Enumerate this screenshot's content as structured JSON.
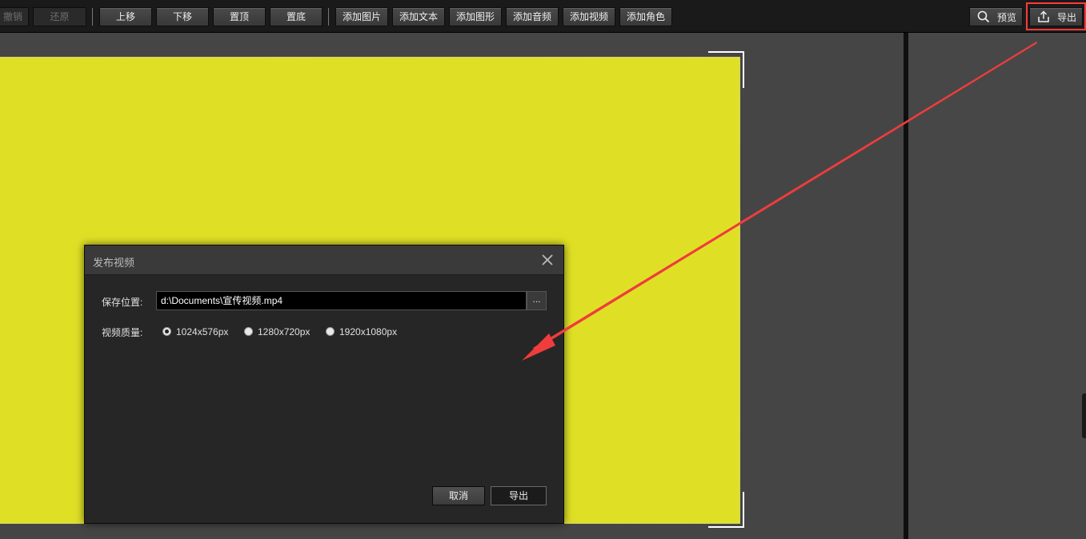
{
  "toolbar": {
    "undo_label": "撤销",
    "redo_label": "还原",
    "move_up_label": "上移",
    "move_down_label": "下移",
    "bring_top_label": "置顶",
    "send_bottom_label": "置底",
    "add_image_label": "添加图片",
    "add_text_label": "添加文本",
    "add_shape_label": "添加图形",
    "add_audio_label": "添加音频",
    "add_video_label": "添加视频",
    "add_character_label": "添加角色",
    "preview_label": "预览",
    "export_label": "导出"
  },
  "dialog": {
    "title": "发布视频",
    "save_location_label": "保存位置:",
    "save_path": "d:\\Documents\\宣传视频.mp4",
    "browse_label": "...",
    "quality_label": "视频质量:",
    "quality_options": [
      {
        "label": "1024x576px",
        "selected": true
      },
      {
        "label": "1280x720px",
        "selected": false
      },
      {
        "label": "1920x1080px",
        "selected": false
      }
    ],
    "cancel_label": "取消",
    "export_label": "导出"
  },
  "colors": {
    "canvas_fill": "#dfe026",
    "highlight": "#ff3b3b",
    "arrow": "#f03c3c"
  }
}
